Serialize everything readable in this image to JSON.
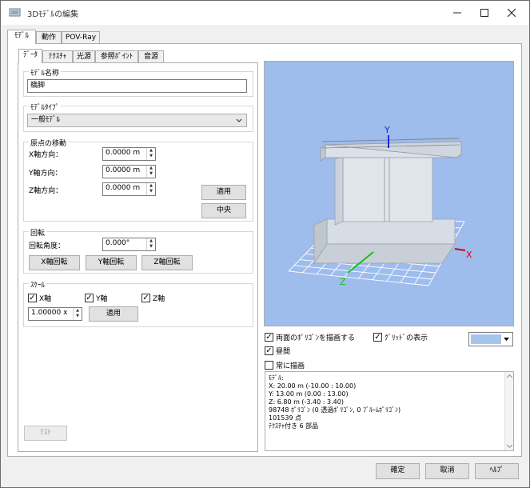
{
  "window": {
    "title": "3Dﾓﾃﾞﾙの編集"
  },
  "main_tabs": [
    "ﾓﾃﾞﾙ",
    "動作",
    "POV-Ray"
  ],
  "sub_tabs": [
    "ﾃﾞｰﾀ",
    "ﾃｸｽﾁｬ",
    "光源",
    "参照ﾎﾟｲﾝﾄ",
    "音源"
  ],
  "model_name": {
    "title": "ﾓﾃﾞﾙ名称",
    "value": "橋脚"
  },
  "model_type": {
    "title": "ﾓﾃﾞﾙﾀｲﾌﾟ",
    "value": "一般ﾓﾃﾞﾙ"
  },
  "origin": {
    "title": "原点の移動",
    "x_label": "X軸方向：",
    "x_value": "0.0000 m",
    "y_label": "Y軸方向：",
    "y_value": "0.0000 m",
    "z_label": "Z軸方向：",
    "z_value": "0.0000 m",
    "apply_label": "適用",
    "center_label": "中央"
  },
  "rotation": {
    "title": "回転",
    "angle_label": "回転角度：",
    "angle_value": "0.000°",
    "x_label": "X軸回転",
    "y_label": "Y軸回転",
    "z_label": "Z軸回転"
  },
  "scale": {
    "title": "ｽｹｰﾙ",
    "x_axis": "X軸",
    "y_axis": "Y軸",
    "z_axis": "Z軸",
    "value": "1.00000 x",
    "apply_label": "適用"
  },
  "test_label": "ﾃｽﾄ",
  "viewport": {
    "bg_color": "#9ebcec",
    "axis_x": "X",
    "axis_y": "Y",
    "axis_z": "Z",
    "color_x": "#e00000",
    "color_y": "#1e2ad6",
    "color_z": "#16c016"
  },
  "options": {
    "double_sided": "両面のﾎﾟﾘｺﾞﾝを描画する",
    "show_grid": "ｸﾞﾘｯﾄﾞの表示",
    "daytime": "昼間",
    "always_draw": "常に描画",
    "grid_color": "#a6c4ec"
  },
  "info": {
    "lines": [
      "ﾓﾃﾞﾙ:",
      "X: 20.00 m (-10.00 : 10.00)",
      "Y: 13.00 m (0.00 : 13.00)",
      "Z: 6.80 m (-3.40 : 3.40)",
      "98748 ﾎﾟﾘｺﾞﾝ (0 透過ﾎﾟﾘｺﾞﾝ, 0 ﾌﾞﾙｰﾑﾎﾟﾘｺﾞﾝ)",
      "101539 点",
      "ﾃｸｽﾁｬ付き 6 部品"
    ]
  },
  "footer": {
    "ok_label": "確定",
    "cancel_label": "取消",
    "help_label": "ﾍﾙﾌﾟ"
  }
}
